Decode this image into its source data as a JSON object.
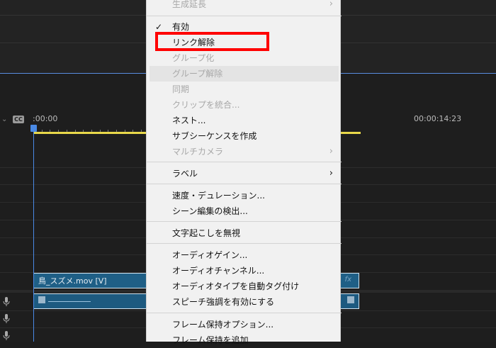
{
  "timeline": {
    "time_start": ":00:00",
    "time_end": "00:00:14:23",
    "cc_label": "CC",
    "video_clip": {
      "name": "鳥_スズメ.mov [V]",
      "fx": "fx"
    }
  },
  "menu": {
    "items": [
      {
        "label": "生成延長",
        "disabled": true,
        "submenu": true
      },
      {
        "label": "有効",
        "checked": true
      },
      {
        "label": "リンク解除"
      },
      {
        "label": "グループ化",
        "disabled": true
      },
      {
        "label": "グループ解除",
        "disabled": true,
        "hover": true
      },
      {
        "label": "同期",
        "disabled": true
      },
      {
        "label": "クリップを統合...",
        "disabled": true
      },
      {
        "label": "ネスト..."
      },
      {
        "label": "サブシーケンスを作成"
      },
      {
        "label": "マルチカメラ",
        "disabled": true,
        "submenu": true
      },
      {
        "label": "ラベル",
        "submenu": true
      },
      {
        "label": "速度・デュレーション..."
      },
      {
        "label": "シーン編集の検出..."
      },
      {
        "label": "文字起こしを無視"
      },
      {
        "label": "オーディオゲイン..."
      },
      {
        "label": "オーディオチャンネル..."
      },
      {
        "label": "オーディオタイプを自動タグ付け"
      },
      {
        "label": "スピーチ強調を有効にする"
      },
      {
        "label": "フレーム保持オプション..."
      },
      {
        "label": "フレーム保持を追加"
      }
    ]
  },
  "colors": {
    "highlight": "#ff0000",
    "clip": "#1f5f86",
    "playhead": "#4a8ae6",
    "work_area": "#e8d84a"
  }
}
